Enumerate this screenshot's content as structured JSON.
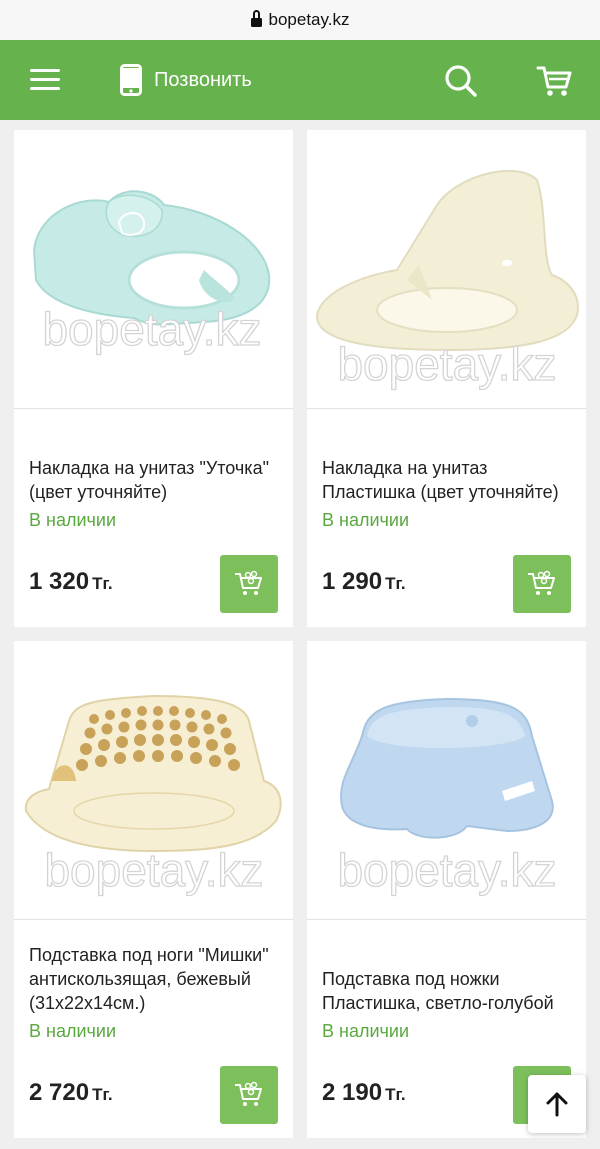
{
  "browser": {
    "url": "bopetay.kz"
  },
  "header": {
    "call_label": "Позвонить"
  },
  "products": [
    {
      "title": "Накладка на унитаз \"Уточка\" (цвет уточняйте)",
      "stock": "В наличии",
      "price": "1 320",
      "currency": "Тг.",
      "watermark": "bopetay.kz"
    },
    {
      "title": "Накладка на унитаз Пластишка (цвет уточняйте)",
      "stock": "В наличии",
      "price": "1 290",
      "currency": "Тг.",
      "watermark": "bopetay.kz"
    },
    {
      "title": "Подставка под ноги \"Мишки\" антискользящая, бежевый (31х22х14см.)",
      "stock": "В наличии",
      "price": "2 720",
      "currency": "Тг.",
      "watermark": "bopetay.kz"
    },
    {
      "title": "Подставка под ножки Пластишка, светло-голубой",
      "stock": "В наличии",
      "price": "2 190",
      "currency": "Тг.",
      "watermark": "bopetay.kz"
    }
  ],
  "colors": {
    "brand_green": "#66b24d",
    "stock_green": "#5aa83f",
    "cart_button": "#7dc05b"
  }
}
